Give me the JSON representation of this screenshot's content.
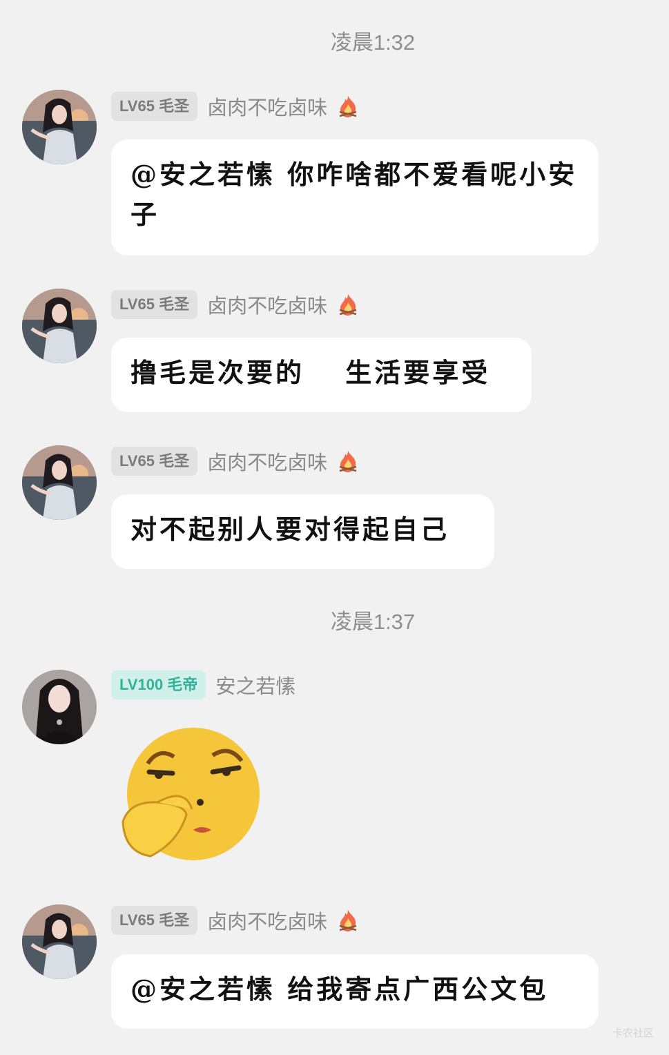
{
  "timestamps": [
    "凌晨1:32",
    "凌晨1:37"
  ],
  "messages": [
    {
      "badge": "LV65 毛圣",
      "user": "卤肉不吃卤味",
      "text": "@安之若愫 你咋啥都不爱看呢小安子"
    },
    {
      "badge": "LV65 毛圣",
      "user": "卤肉不吃卤味",
      "text": "撸毛是次要的　 生活要享受"
    },
    {
      "badge": "LV65 毛圣",
      "user": "卤肉不吃卤味",
      "text": "对不起别人要对得起自己"
    },
    {
      "badge": "LV100 毛帝",
      "user": "安之若愫",
      "sticker": "smirk-thinking-emoji"
    },
    {
      "badge": "LV65 毛圣",
      "user": "卤肉不吃卤味",
      "text": "@安之若愫 给我寄点广西公文包"
    }
  ],
  "icons": {
    "user_flair": "fire-icon"
  },
  "colors": {
    "background": "#f1f1f1",
    "bubble": "#ffffff",
    "badge_gray": "#e2e2e2",
    "badge_teal": "#2fb39a"
  },
  "watermark": "卡农社区"
}
